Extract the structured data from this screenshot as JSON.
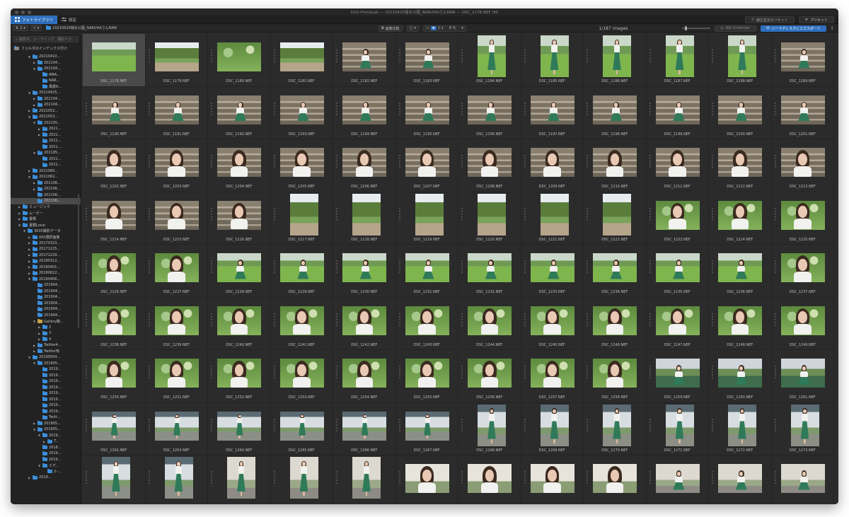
{
  "window": {
    "title": "DxO PhotoLab — 20210620瑞水公園_NARUHAさんRAW — DSC_1178.NEF (M)"
  },
  "tabs": [
    {
      "label": "フォトライブラリ",
      "active": true,
      "icon": "grid-icon"
    },
    {
      "label": "設定",
      "active": false,
      "icon": "sliders-icon"
    }
  ],
  "tabbar_right": {
    "reset_label": "補正設定のリセット",
    "preset_label": "プリセット"
  },
  "toolbar": {
    "sort_label": "1",
    "filter_label": "",
    "breadcrumb": "20210620瑞水公園_NARUHAさんRAW",
    "compare_label": "画像比較",
    "ratio_label": "1:1",
    "zoom_value": "6 %",
    "image_count": "1/187 images",
    "nik_label": "Nik Collection",
    "export_label": "ハードディスクにエクスポート"
  },
  "sidebar": {
    "search_placeholder": "撮影日、レーティング、撮影パラ",
    "index_label": "フォルダのインデックス付け",
    "tree": [
      {
        "label": "20210410...",
        "indent": 4,
        "open": true,
        "color": "blue"
      },
      {
        "label": "202104...",
        "indent": 5,
        "open": false,
        "color": "blue"
      },
      {
        "label": "202104...",
        "indent": 5,
        "open": true,
        "color": "blue"
      },
      {
        "label": "AMA...",
        "indent": 6,
        "open": null,
        "color": "blue"
      },
      {
        "label": "NAR...",
        "indent": 6,
        "open": null,
        "color": "blue"
      },
      {
        "label": "風景R...",
        "indent": 6,
        "open": null,
        "color": "blue"
      },
      {
        "label": "20210425...",
        "indent": 4,
        "open": true,
        "color": "blue"
      },
      {
        "label": "202104...",
        "indent": 5,
        "open": false,
        "color": "blue"
      },
      {
        "label": "202104...",
        "indent": 5,
        "open": false,
        "color": "blue"
      },
      {
        "label": "2021052...",
        "indent": 4,
        "open": false,
        "color": "blue"
      },
      {
        "label": "2021053...",
        "indent": 4,
        "open": true,
        "color": "blue"
      },
      {
        "label": "202105...",
        "indent": 5,
        "open": true,
        "color": "blue"
      },
      {
        "label": "2021...",
        "indent": 6,
        "open": false,
        "color": "blue"
      },
      {
        "label": "2021...",
        "indent": 6,
        "open": false,
        "color": "blue"
      },
      {
        "label": "2021...",
        "indent": 6,
        "open": null,
        "color": "blue"
      },
      {
        "label": "2021...",
        "indent": 6,
        "open": null,
        "color": "blue"
      },
      {
        "label": "202105...",
        "indent": 5,
        "open": true,
        "color": "blue"
      },
      {
        "label": "2021...",
        "indent": 6,
        "open": null,
        "color": "blue"
      },
      {
        "label": "2021...",
        "indent": 6,
        "open": null,
        "color": "blue"
      },
      {
        "label": "2021060...",
        "indent": 4,
        "open": false,
        "color": "blue"
      },
      {
        "label": "2021062...",
        "indent": 4,
        "open": true,
        "color": "blue"
      },
      {
        "label": "202106...",
        "indent": 5,
        "open": false,
        "color": "blue"
      },
      {
        "label": "202106...",
        "indent": 5,
        "open": false,
        "color": "blue"
      },
      {
        "label": "202106...",
        "indent": 5,
        "open": null,
        "color": "blue"
      },
      {
        "label": "202106...",
        "indent": 5,
        "open": null,
        "color": "blue",
        "selected": true
      },
      {
        "label": "ミュージック",
        "indent": 2,
        "open": false,
        "color": "blue"
      },
      {
        "label": "ムービー",
        "indent": 2,
        "open": false,
        "color": "blue"
      },
      {
        "label": "書類",
        "indent": 2,
        "open": false,
        "color": "blue"
      },
      {
        "label": "書類Local",
        "indent": 2,
        "open": true,
        "color": "blue"
      },
      {
        "label": "3635撮影データ",
        "indent": 3,
        "open": true,
        "color": "blue"
      },
      {
        "label": "000選択画像",
        "indent": 4,
        "open": false,
        "color": "blue"
      },
      {
        "label": "20170323...",
        "indent": 4,
        "open": false,
        "color": "blue"
      },
      {
        "label": "20171225...",
        "indent": 4,
        "open": false,
        "color": "blue"
      },
      {
        "label": "20171229...",
        "indent": 4,
        "open": false,
        "color": "blue"
      },
      {
        "label": "20180312...",
        "indent": 4,
        "open": false,
        "color": "blue"
      },
      {
        "label": "20180401...",
        "indent": 4,
        "open": false,
        "color": "blue"
      },
      {
        "label": "20180622...",
        "indent": 4,
        "open": false,
        "color": "blue"
      },
      {
        "label": "20190406...",
        "indent": 4,
        "open": true,
        "color": "blue"
      },
      {
        "label": "201904...",
        "indent": 5,
        "open": null,
        "color": "blue"
      },
      {
        "label": "201904...",
        "indent": 5,
        "open": null,
        "color": "blue"
      },
      {
        "label": "201904...",
        "indent": 5,
        "open": null,
        "color": "blue"
      },
      {
        "label": "201904...",
        "indent": 5,
        "open": null,
        "color": "blue"
      },
      {
        "label": "201904...",
        "indent": 5,
        "open": null,
        "color": "blue"
      },
      {
        "label": "201904...",
        "indent": 5,
        "open": null,
        "color": "blue"
      },
      {
        "label": "Gallery撮...",
        "indent": 5,
        "open": true,
        "color": "yellow"
      },
      {
        "label": "2",
        "indent": 6,
        "open": false,
        "color": "blue"
      },
      {
        "label": "3",
        "indent": 6,
        "open": false,
        "color": "blue"
      },
      {
        "label": "4",
        "indent": 6,
        "open": false,
        "color": "blue"
      },
      {
        "label": "Twitter4...",
        "indent": 5,
        "open": false,
        "color": "blue"
      },
      {
        "label": "Twitter用",
        "indent": 5,
        "open": false,
        "color": "blue"
      },
      {
        "label": "20190504...",
        "indent": 4,
        "open": true,
        "color": "blue"
      },
      {
        "label": "201905...",
        "indent": 5,
        "open": true,
        "color": "blue"
      },
      {
        "label": "2019...",
        "indent": 6,
        "open": null,
        "color": "blue"
      },
      {
        "label": "2019...",
        "indent": 6,
        "open": null,
        "color": "blue"
      },
      {
        "label": "2019...",
        "indent": 6,
        "open": null,
        "color": "blue"
      },
      {
        "label": "2019...",
        "indent": 6,
        "open": null,
        "color": "blue"
      },
      {
        "label": "2019...",
        "indent": 6,
        "open": null,
        "color": "blue"
      },
      {
        "label": "2019...",
        "indent": 6,
        "open": null,
        "color": "blue"
      },
      {
        "label": "2019...",
        "indent": 6,
        "open": null,
        "color": "blue"
      },
      {
        "label": "2019...",
        "indent": 6,
        "open": null,
        "color": "blue"
      },
      {
        "label": "Twitt...",
        "indent": 6,
        "open": null,
        "color": "blue"
      },
      {
        "label": "201905...",
        "indent": 5,
        "open": false,
        "color": "blue"
      },
      {
        "label": "201905...",
        "indent": 5,
        "open": true,
        "color": "blue"
      },
      {
        "label": "2019...",
        "indent": 6,
        "open": true,
        "color": "blue"
      },
      {
        "label": "T...",
        "indent": 7,
        "open": false,
        "color": "blue"
      },
      {
        "label": "2018...",
        "indent": 6,
        "open": null,
        "color": "blue"
      },
      {
        "label": "2019...",
        "indent": 6,
        "open": null,
        "color": "blue"
      },
      {
        "label": "2019...",
        "indent": 6,
        "open": null,
        "color": "blue"
      },
      {
        "label": "ミデ...",
        "indent": 6,
        "open": true,
        "color": "blue"
      },
      {
        "label": "2-...",
        "indent": 7,
        "open": null,
        "color": "blue"
      },
      {
        "label": "2019...",
        "indent": 4,
        "open": false,
        "color": "blue"
      }
    ]
  },
  "thumbnails": [
    {
      "name": "DSC_1178.NEF",
      "o": "l",
      "s": "park",
      "p": "none",
      "sel": true
    },
    {
      "name": "DSC_1179.NEF",
      "o": "l",
      "s": "trees",
      "p": "none"
    },
    {
      "name": "DSC_1180.NEF",
      "o": "l",
      "s": "bokeh",
      "p": "none"
    },
    {
      "name": "DSC_1181.NEF",
      "o": "l",
      "s": "trees",
      "p": "none"
    },
    {
      "name": "DSC_1182.NEF",
      "o": "l",
      "s": "stairs",
      "p": "sit"
    },
    {
      "name": "DSC_1183.NEF",
      "o": "l",
      "s": "stairs",
      "p": "sit"
    },
    {
      "name": "DSC_1184.NEF",
      "o": "p",
      "s": "park",
      "p": "stand"
    },
    {
      "name": "DSC_1185.NEF",
      "o": "p",
      "s": "park",
      "p": "stand"
    },
    {
      "name": "DSC_1186.NEF",
      "o": "p",
      "s": "park",
      "p": "stand"
    },
    {
      "name": "DSC_1187.NEF",
      "o": "p",
      "s": "park",
      "p": "stand"
    },
    {
      "name": "DSC_1188.NEF",
      "o": "p",
      "s": "park",
      "p": "stand"
    },
    {
      "name": "DSC_1189.NEF",
      "o": "l",
      "s": "stairs",
      "p": "sit"
    },
    {
      "name": "DSC_1190.NEF",
      "o": "l",
      "s": "stairs",
      "p": "sit"
    },
    {
      "name": "DSC_1191.NEF",
      "o": "l",
      "s": "stairs",
      "p": "sit"
    },
    {
      "name": "DSC_1192.NEF",
      "o": "l",
      "s": "stairs",
      "p": "sit"
    },
    {
      "name": "DSC_1193.NEF",
      "o": "l",
      "s": "stairs",
      "p": "sit"
    },
    {
      "name": "DSC_1194.NEF",
      "o": "l",
      "s": "stairs",
      "p": "sit"
    },
    {
      "name": "DSC_1195.NEF",
      "o": "l",
      "s": "stairs",
      "p": "sit"
    },
    {
      "name": "DSC_1196.NEF",
      "o": "l",
      "s": "stairs",
      "p": "sit"
    },
    {
      "name": "DSC_1197.NEF",
      "o": "l",
      "s": "stairs",
      "p": "sit"
    },
    {
      "name": "DSC_1198.NEF",
      "o": "l",
      "s": "stairs",
      "p": "sit"
    },
    {
      "name": "DSC_1199.NEF",
      "o": "l",
      "s": "stairs",
      "p": "sit"
    },
    {
      "name": "DSC_1200.NEF",
      "o": "l",
      "s": "stairs",
      "p": "sit"
    },
    {
      "name": "DSC_1201.NEF",
      "o": "l",
      "s": "stairs",
      "p": "sit"
    },
    {
      "name": "DSC_1202.NEF",
      "o": "l",
      "s": "stairs",
      "p": "close"
    },
    {
      "name": "DSC_1203.NEF",
      "o": "l",
      "s": "stairs",
      "p": "close"
    },
    {
      "name": "DSC_1204.NEF",
      "o": "l",
      "s": "stairs",
      "p": "close"
    },
    {
      "name": "DSC_1205.NEF",
      "o": "l",
      "s": "stairs",
      "p": "close"
    },
    {
      "name": "DSC_1206.NEF",
      "o": "l",
      "s": "stairs",
      "p": "close"
    },
    {
      "name": "DSC_1207.NEF",
      "o": "l",
      "s": "stairs",
      "p": "close"
    },
    {
      "name": "DSC_1208.NEF",
      "o": "l",
      "s": "stairs",
      "p": "close"
    },
    {
      "name": "DSC_1209.NEF",
      "o": "l",
      "s": "stairs",
      "p": "close"
    },
    {
      "name": "DSC_1210.NEF",
      "o": "l",
      "s": "stairs",
      "p": "close"
    },
    {
      "name": "DSC_1211.NEF",
      "o": "l",
      "s": "stairs",
      "p": "close"
    },
    {
      "name": "DSC_1212.NEF",
      "o": "l",
      "s": "stairs",
      "p": "close"
    },
    {
      "name": "DSC_1213.NEF",
      "o": "l",
      "s": "stairs",
      "p": "close"
    },
    {
      "name": "DSC_1214.NEF",
      "o": "l",
      "s": "stairs",
      "p": "close"
    },
    {
      "name": "DSC_1215.NEF",
      "o": "l",
      "s": "stairs",
      "p": "close"
    },
    {
      "name": "DSC_1216.NEF",
      "o": "l",
      "s": "stairs",
      "p": "close"
    },
    {
      "name": "DSC_1217.NEF",
      "o": "p",
      "s": "trees",
      "p": "none"
    },
    {
      "name": "DSC_1218.NEF",
      "o": "p",
      "s": "trees",
      "p": "none"
    },
    {
      "name": "DSC_1219.NEF",
      "o": "p",
      "s": "trees",
      "p": "none"
    },
    {
      "name": "DSC_1220.NEF",
      "o": "p",
      "s": "trees",
      "p": "none"
    },
    {
      "name": "DSC_1221.NEF",
      "o": "p",
      "s": "trees",
      "p": "none"
    },
    {
      "name": "DSC_1222.NEF",
      "o": "p",
      "s": "trees",
      "p": "none"
    },
    {
      "name": "DSC_1223.NEF",
      "o": "l",
      "s": "bokeh",
      "p": "close"
    },
    {
      "name": "DSC_1224.NEF",
      "o": "l",
      "s": "bokeh",
      "p": "close"
    },
    {
      "name": "DSC_1225.NEF",
      "o": "l",
      "s": "bokeh",
      "p": "close"
    },
    {
      "name": "DSC_1226.NEF",
      "o": "l",
      "s": "bokeh",
      "p": "close"
    },
    {
      "name": "DSC_1227.NEF",
      "o": "l",
      "s": "bokeh",
      "p": "close"
    },
    {
      "name": "DSC_1228.NEF",
      "o": "l",
      "s": "park",
      "p": "sit"
    },
    {
      "name": "DSC_1229.NEF",
      "o": "l",
      "s": "park",
      "p": "sit"
    },
    {
      "name": "DSC_1230.NEF",
      "o": "l",
      "s": "park",
      "p": "sit"
    },
    {
      "name": "DSC_1231.NEF",
      "o": "l",
      "s": "park",
      "p": "sit"
    },
    {
      "name": "DSC_1232.NEF",
      "o": "l",
      "s": "park",
      "p": "sit"
    },
    {
      "name": "DSC_1233.NEF",
      "o": "l",
      "s": "park",
      "p": "sit"
    },
    {
      "name": "DSC_1234.NEF",
      "o": "l",
      "s": "park",
      "p": "sit"
    },
    {
      "name": "DSC_1235.NEF",
      "o": "l",
      "s": "park",
      "p": "sit"
    },
    {
      "name": "DSC_1236.NEF",
      "o": "l",
      "s": "park",
      "p": "sit"
    },
    {
      "name": "DSC_1237.NEF",
      "o": "l",
      "s": "bokeh",
      "p": "close"
    },
    {
      "name": "DSC_1238.NEF",
      "o": "l",
      "s": "bokeh",
      "p": "close"
    },
    {
      "name": "DSC_1239.NEF",
      "o": "l",
      "s": "bokeh",
      "p": "close"
    },
    {
      "name": "DSC_1240.NEF",
      "o": "l",
      "s": "bokeh",
      "p": "close"
    },
    {
      "name": "DSC_1241.NEF",
      "o": "l",
      "s": "bokeh",
      "p": "close"
    },
    {
      "name": "DSC_1242.NEF",
      "o": "l",
      "s": "bokeh",
      "p": "close"
    },
    {
      "name": "DSC_1243.NEF",
      "o": "l",
      "s": "bokeh",
      "p": "close"
    },
    {
      "name": "DSC_1244.NEF",
      "o": "l",
      "s": "bokeh",
      "p": "close"
    },
    {
      "name": "DSC_1245.NEF",
      "o": "l",
      "s": "bokeh",
      "p": "close"
    },
    {
      "name": "DSC_1246.NEF",
      "o": "l",
      "s": "bokeh",
      "p": "close"
    },
    {
      "name": "DSC_1247.NEF",
      "o": "l",
      "s": "bokeh",
      "p": "close"
    },
    {
      "name": "DSC_1248.NEF",
      "o": "l",
      "s": "bokeh",
      "p": "close"
    },
    {
      "name": "DSC_1249.NEF",
      "o": "l",
      "s": "bokeh",
      "p": "close"
    },
    {
      "name": "DSC_1250.NEF",
      "o": "l",
      "s": "bokeh",
      "p": "close"
    },
    {
      "name": "DSC_1251.NEF",
      "o": "l",
      "s": "bokeh",
      "p": "close"
    },
    {
      "name": "DSC_1252.NEF",
      "o": "l",
      "s": "bokeh",
      "p": "close"
    },
    {
      "name": "DSC_1253.NEF",
      "o": "l",
      "s": "bokeh",
      "p": "close"
    },
    {
      "name": "DSC_1254.NEF",
      "o": "l",
      "s": "bokeh",
      "p": "close"
    },
    {
      "name": "DSC_1255.NEF",
      "o": "l",
      "s": "bokeh",
      "p": "close"
    },
    {
      "name": "DSC_1256.NEF",
      "o": "l",
      "s": "bokeh",
      "p": "close"
    },
    {
      "name": "DSC_1257.NEF",
      "o": "l",
      "s": "bokeh",
      "p": "close"
    },
    {
      "name": "DSC_1258.NEF",
      "o": "l",
      "s": "bokeh",
      "p": "close"
    },
    {
      "name": "DSC_1259.NEF",
      "o": "l",
      "s": "mixed",
      "p": "sit"
    },
    {
      "name": "DSC_1260.NEF",
      "o": "l",
      "s": "mixed",
      "p": "sit"
    },
    {
      "name": "DSC_1261.NEF",
      "o": "l",
      "s": "mixed",
      "p": "sit"
    },
    {
      "name": "DSC_1262.NEF",
      "o": "l",
      "s": "bridge",
      "p": "stand"
    },
    {
      "name": "DSC_1263.NEF",
      "o": "l",
      "s": "bridge",
      "p": "stand"
    },
    {
      "name": "DSC_1264.NEF",
      "o": "l",
      "s": "bridge",
      "p": "stand"
    },
    {
      "name": "DSC_1265.NEF",
      "o": "l",
      "s": "bridge",
      "p": "stand"
    },
    {
      "name": "DSC_1266.NEF",
      "o": "l",
      "s": "bridge",
      "p": "stand"
    },
    {
      "name": "DSC_1267.NEF",
      "o": "l",
      "s": "bridge",
      "p": "stand"
    },
    {
      "name": "DSC_1268.NEF",
      "o": "p",
      "s": "bridge",
      "p": "stand"
    },
    {
      "name": "DSC_1269.NEF",
      "o": "p",
      "s": "bridge",
      "p": "stand"
    },
    {
      "name": "DSC_1270.NEF",
      "o": "p",
      "s": "bridge",
      "p": "stand"
    },
    {
      "name": "DSC_1271.NEF",
      "o": "p",
      "s": "bridge",
      "p": "stand"
    },
    {
      "name": "DSC_1272.NEF",
      "o": "p",
      "s": "bridge",
      "p": "stand"
    },
    {
      "name": "DSC_1273.NEF",
      "o": "p",
      "s": "bridge",
      "p": "stand"
    },
    {
      "name": "",
      "o": "p",
      "s": "bridge",
      "p": "stand"
    },
    {
      "name": "",
      "o": "p",
      "s": "bridge",
      "p": "stand"
    },
    {
      "name": "",
      "o": "p",
      "s": "stone",
      "p": "stand"
    },
    {
      "name": "",
      "o": "p",
      "s": "stone",
      "p": "stand"
    },
    {
      "name": "",
      "o": "p",
      "s": "stone",
      "p": "stand"
    },
    {
      "name": "",
      "o": "l",
      "s": "light",
      "p": "close"
    },
    {
      "name": "",
      "o": "l",
      "s": "light",
      "p": "close"
    },
    {
      "name": "",
      "o": "l",
      "s": "light",
      "p": "close"
    },
    {
      "name": "",
      "o": "l",
      "s": "light",
      "p": "close"
    },
    {
      "name": "",
      "o": "l",
      "s": "stone",
      "p": "sit"
    },
    {
      "name": "",
      "o": "l",
      "s": "stone",
      "p": "sit"
    },
    {
      "name": "",
      "o": "l",
      "s": "stone",
      "p": "sit"
    }
  ],
  "colors": {
    "accent": "#2e6fbd",
    "folder": "#3b8edb",
    "folder_special": "#c9a54a",
    "panel": "#2b2b2b",
    "selected_cell": "#4a4a4a"
  }
}
